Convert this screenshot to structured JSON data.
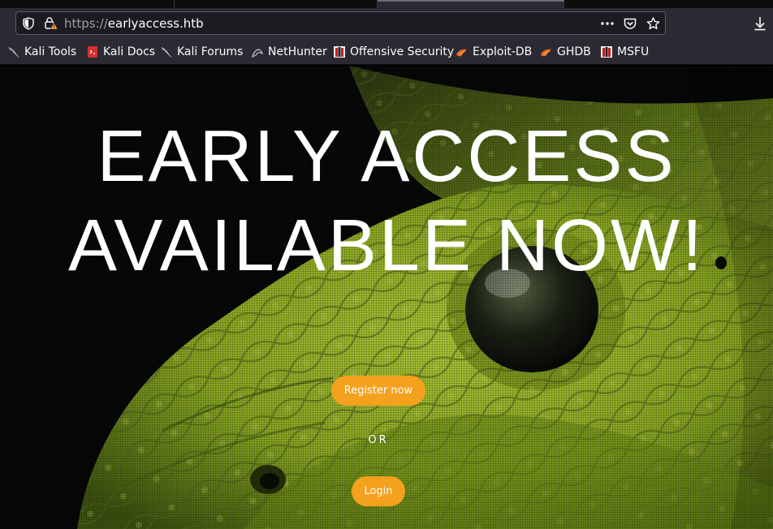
{
  "browser": {
    "url_scheme": "https://",
    "url_host": "earlyaccess.htb",
    "more_icon": "ellipsis-icon",
    "pocket_icon": "pocket-icon",
    "bookmark_icon": "star-icon",
    "downloads_icon": "download-arrow-icon"
  },
  "bookmarks": [
    {
      "label": "Kali Tools",
      "icon": "kali-dragon-icon"
    },
    {
      "label": "Kali Docs",
      "icon": "kali-docs-icon"
    },
    {
      "label": "Kali Forums",
      "icon": "kali-dragon-icon"
    },
    {
      "label": "NetHunter",
      "icon": "nethunter-icon"
    },
    {
      "label": "Offensive Security",
      "icon": "offsec-icon"
    },
    {
      "label": "Exploit-DB",
      "icon": "exploitdb-icon"
    },
    {
      "label": "GHDB",
      "icon": "exploitdb-icon"
    },
    {
      "label": "MSFU",
      "icon": "offsec-icon"
    }
  ],
  "hero": {
    "line1": "EARLY ACCESS",
    "line2": "AVAILABLE NOW!",
    "register_label": "Register now",
    "or_label": "OR",
    "login_label": "Login"
  },
  "colors": {
    "button": "#f4a11d",
    "snake": "#9cba2c"
  }
}
